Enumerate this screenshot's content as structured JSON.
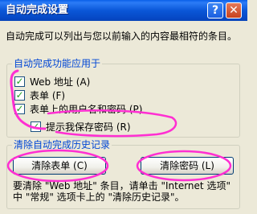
{
  "window": {
    "title": "自动完成设置",
    "help_button": "?",
    "close_button": "✕"
  },
  "description": "自动完成可以列出与您以前输入的内容最相符的条目。",
  "autocomplete_group": {
    "legend": "自动完成功能应用于",
    "options": [
      {
        "label": "Web 地址 (A)",
        "checked": true
      },
      {
        "label": "表单 (F)",
        "checked": true
      },
      {
        "label": "表单上的用户名和密码 (P)",
        "checked": true
      },
      {
        "label": "提示我保存密码 (R)",
        "checked": true
      }
    ]
  },
  "history_group": {
    "legend": "清除自动完成历史记录",
    "clear_forms_button": "清除表单 (C)",
    "clear_passwords_button": "清除密码 (L)",
    "note_line1": "要清除 \"Web 地址\" 条目，请单击 \"Internet 选项\"",
    "note_line2": "中 \"常规\" 选项卡上的 \"清除历史记录\"。"
  },
  "icons": {
    "check": "✓"
  },
  "colors": {
    "titlebar": "#0a57d8",
    "legend": "#0046d5",
    "annotation": "#ff2fd2"
  }
}
